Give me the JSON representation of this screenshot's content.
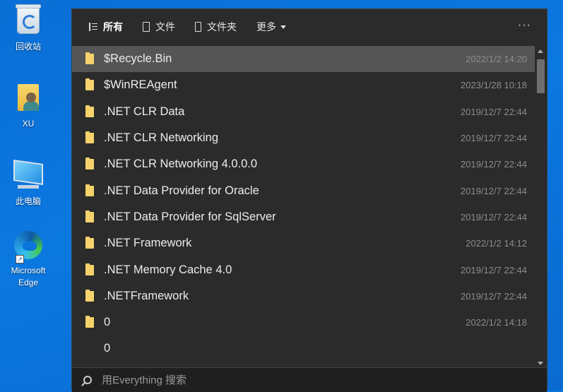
{
  "desktop": {
    "icons": [
      {
        "label": "回收站"
      },
      {
        "label": "XU"
      },
      {
        "label": "此电脑"
      },
      {
        "label": "Microsoft Edge"
      }
    ]
  },
  "tabs": [
    {
      "label": "所有"
    },
    {
      "label": "文件"
    },
    {
      "label": "文件夹"
    },
    {
      "label": "更多"
    }
  ],
  "more_label": "···",
  "results": [
    {
      "name": "$Recycle.Bin",
      "date": "2022/1/2 14:20"
    },
    {
      "name": "$WinREAgent",
      "date": "2023/1/28 10:18"
    },
    {
      "name": ".NET CLR Data",
      "date": "2019/12/7 22:44"
    },
    {
      "name": ".NET CLR Networking",
      "date": "2019/12/7 22:44"
    },
    {
      "name": ".NET CLR Networking 4.0.0.0",
      "date": "2019/12/7 22:44"
    },
    {
      "name": ".NET Data Provider for Oracle",
      "date": "2019/12/7 22:44"
    },
    {
      "name": ".NET Data Provider for SqlServer",
      "date": "2019/12/7 22:44"
    },
    {
      "name": ".NET Framework",
      "date": "2022/1/2 14:12"
    },
    {
      "name": ".NET Memory Cache 4.0",
      "date": "2019/12/7 22:44"
    },
    {
      "name": ".NETFramework",
      "date": "2019/12/7 22:44"
    },
    {
      "name": "0",
      "date": "2022/1/2 14:18"
    },
    {
      "name": "0",
      "date": ""
    }
  ],
  "search": {
    "placeholder": "用Everything 搜索",
    "value": ""
  },
  "colors": {
    "folder": "#f5d26b",
    "selected_row": "#555555",
    "window_bg": "#2b2b2b"
  }
}
